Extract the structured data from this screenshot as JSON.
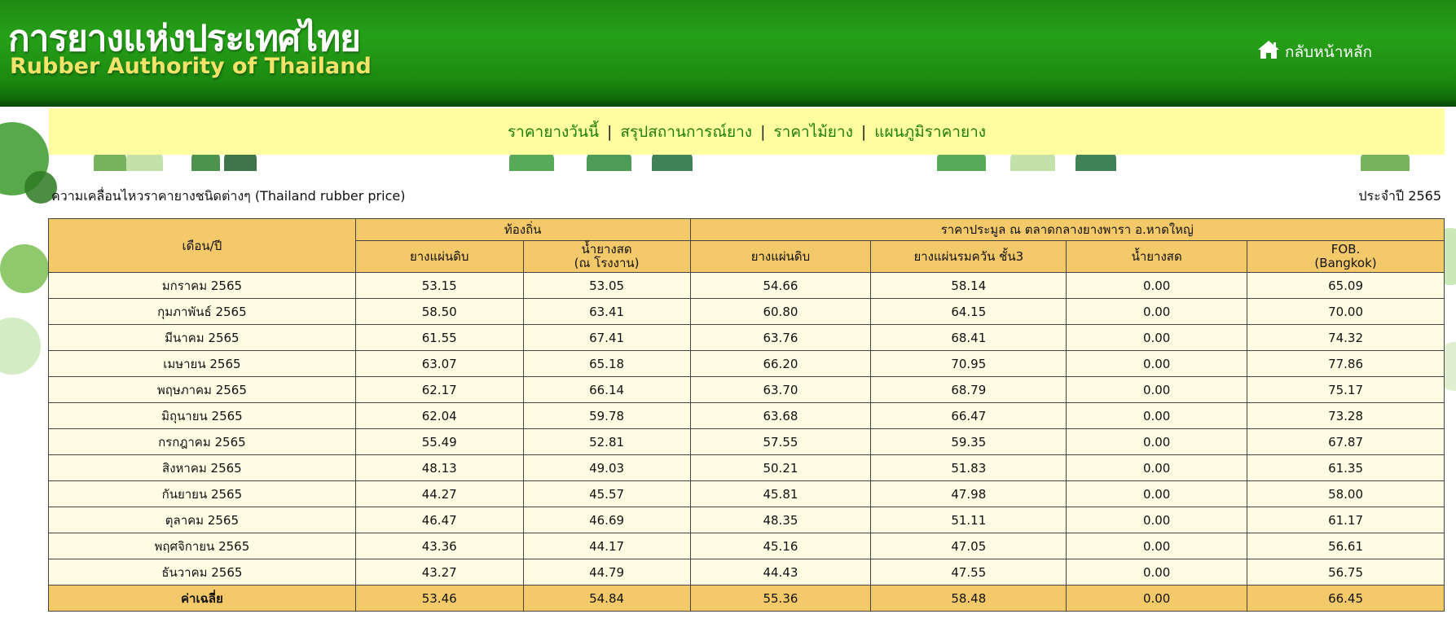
{
  "header": {
    "logo_thai": "การยางแห่งประเทศไทย",
    "logo_en": "Rubber Authority of Thailand",
    "home_label": "กลับหน้าหลัก",
    "home_icon": "home-icon"
  },
  "nav": {
    "items": [
      {
        "label": "ราคายางวันนี้"
      },
      {
        "label": "สรุปสถานการณ์ยาง"
      },
      {
        "label": "ราคาไม้ยาง"
      },
      {
        "label": "แผนภูมิราคายาง"
      }
    ],
    "separator": "|"
  },
  "caption": {
    "left": "ความเคลื่อนไหวราคายางชนิดต่างๆ (Thailand rubber price)",
    "right": "ประจำปี 2565"
  },
  "table": {
    "month_header": "เดือน/ปี",
    "group_local": "ท้องถิ่น",
    "group_market": "ราคาประมูล ณ ตลาดกลางยางพารา อ.หาดใหญ่",
    "columns": [
      {
        "line1": "ยางแผ่นดิบ",
        "line2": ""
      },
      {
        "line1": "น้ำยางสด",
        "line2": "(ณ โรงงาน)"
      },
      {
        "line1": "ยางแผ่นดิบ",
        "line2": ""
      },
      {
        "line1": "ยางแผ่นรมควัน ชั้น3",
        "line2": ""
      },
      {
        "line1": "น้ำยางสด",
        "line2": ""
      },
      {
        "line1": "FOB.",
        "line2": "(Bangkok)"
      }
    ],
    "rows": [
      {
        "month": "มกราคม 2565",
        "v": [
          "53.15",
          "53.05",
          "54.66",
          "58.14",
          "0.00",
          "65.09"
        ]
      },
      {
        "month": "กุมภาพันธ์ 2565",
        "v": [
          "58.50",
          "63.41",
          "60.80",
          "64.15",
          "0.00",
          "70.00"
        ]
      },
      {
        "month": "มีนาคม 2565",
        "v": [
          "61.55",
          "67.41",
          "63.76",
          "68.41",
          "0.00",
          "74.32"
        ]
      },
      {
        "month": "เมษายน 2565",
        "v": [
          "63.07",
          "65.18",
          "66.20",
          "70.95",
          "0.00",
          "77.86"
        ]
      },
      {
        "month": "พฤษภาคม 2565",
        "v": [
          "62.17",
          "66.14",
          "63.70",
          "68.79",
          "0.00",
          "75.17"
        ]
      },
      {
        "month": "มิถุนายน 2565",
        "v": [
          "62.04",
          "59.78",
          "63.68",
          "66.47",
          "0.00",
          "73.28"
        ]
      },
      {
        "month": "กรกฎาคม 2565",
        "v": [
          "55.49",
          "52.81",
          "57.55",
          "59.35",
          "0.00",
          "67.87"
        ]
      },
      {
        "month": "สิงหาคม 2565",
        "v": [
          "48.13",
          "49.03",
          "50.21",
          "51.83",
          "0.00",
          "61.35"
        ]
      },
      {
        "month": "กันยายน 2565",
        "v": [
          "44.27",
          "45.57",
          "45.81",
          "47.98",
          "0.00",
          "58.00"
        ]
      },
      {
        "month": "ตุลาคม 2565",
        "v": [
          "46.47",
          "46.69",
          "48.35",
          "51.11",
          "0.00",
          "61.17"
        ]
      },
      {
        "month": "พฤศจิกายน 2565",
        "v": [
          "43.36",
          "44.17",
          "45.16",
          "47.05",
          "0.00",
          "56.61"
        ]
      },
      {
        "month": "ธันวาคม 2565",
        "v": [
          "43.27",
          "44.79",
          "44.43",
          "47.55",
          "0.00",
          "56.75"
        ]
      }
    ],
    "average": {
      "label": "ค่าเฉลี่ย",
      "v": [
        "53.46",
        "54.84",
        "55.36",
        "58.48",
        "0.00",
        "66.45"
      ]
    }
  },
  "colors": {
    "header_green": "#1f8a12",
    "nav_bg": "#fefea0",
    "nav_link": "#1f7e0a",
    "table_header": "#f4c96a",
    "table_row": "#fefde3",
    "logo_en": "#f3e36a"
  }
}
